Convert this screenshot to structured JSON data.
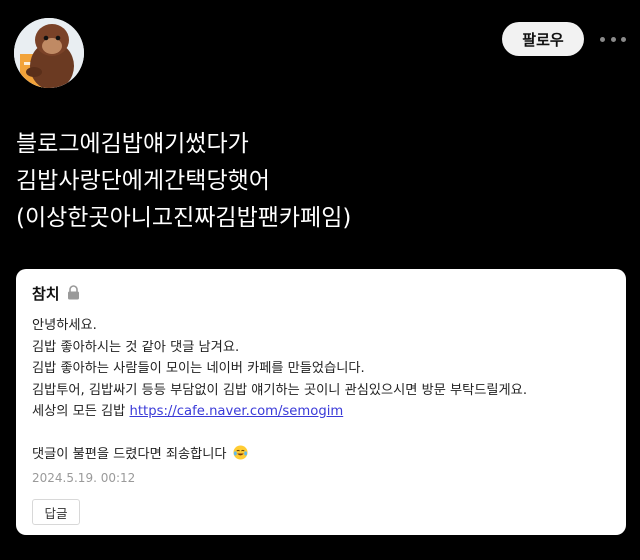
{
  "header": {
    "avatar_icon": "orangutan-plush-avatar",
    "follow_label": "팔로우",
    "more_icon": "more-dots-icon"
  },
  "post": {
    "lines": [
      "블로그에김밥얘기썼다가",
      "김밥사랑단에게간택당햇어",
      "(이상한곳아니고진짜김밥팬카페임)"
    ]
  },
  "comment_card": {
    "author": "참치",
    "lock_icon": "lock-icon",
    "body": {
      "line1": "안녕하세요.",
      "line2": "김밥 좋아하시는 것 같아 댓글 남겨요.",
      "line3": "김밥 좋아하는 사람들이 모이는 네이버 카페를 만들었습니다.",
      "line4": "김밥투어, 김밥싸기 등등 부담없이 김밥 얘기하는 곳이니 관심있으시면 방문 부탁드릴게요.",
      "line5_prefix": "세상의 모든 김밥 ",
      "link": "https://cafe.naver.com/semogim",
      "line6": "댓글이 불편을 드렸다면 죄송합니다",
      "emoji_icon": "crying-laughing-emoji-icon"
    },
    "date": "2024.5.19. 00:12",
    "reply_label": "답글"
  }
}
